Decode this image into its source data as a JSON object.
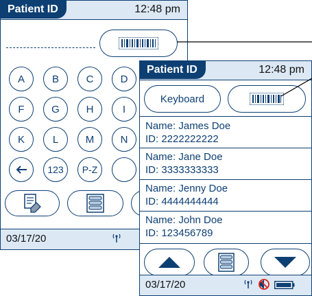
{
  "back_screen": {
    "header": {
      "title": "Patient ID",
      "time": "12:48 pm"
    },
    "keys_row1": [
      "A",
      "B",
      "C",
      "D"
    ],
    "keys_row2": [
      "F",
      "G",
      "H",
      "I"
    ],
    "keys_row3": [
      "K",
      "L",
      "M",
      "N"
    ],
    "keys_row4": {
      "num": "123",
      "range": "P-Z"
    },
    "footer": {
      "date": "03/17/20"
    }
  },
  "front_screen": {
    "header": {
      "title": "Patient ID",
      "time": "12:48 pm"
    },
    "keyboard_label": "Keyboard",
    "patients": [
      {
        "name": "Name: James Doe",
        "id": "ID: 2222222222"
      },
      {
        "name": "Name: Jane Doe",
        "id": "ID: 3333333333"
      },
      {
        "name": "Name: Jenny Doe",
        "id": "ID: 4444444444"
      },
      {
        "name": "Name: John Doe",
        "id": "ID: 123456789"
      }
    ],
    "footer": {
      "date": "03/17/20"
    }
  },
  "colors": {
    "primary": "#0d3f73",
    "header_bg": "#dce8f4"
  },
  "icons": [
    "barcode-icon",
    "backspace-arrow-icon",
    "edit-eraser-icon",
    "list-icon",
    "scroll-up-icon",
    "scroll-down-icon",
    "antenna-icon",
    "no-sound-icon",
    "battery-icon"
  ]
}
